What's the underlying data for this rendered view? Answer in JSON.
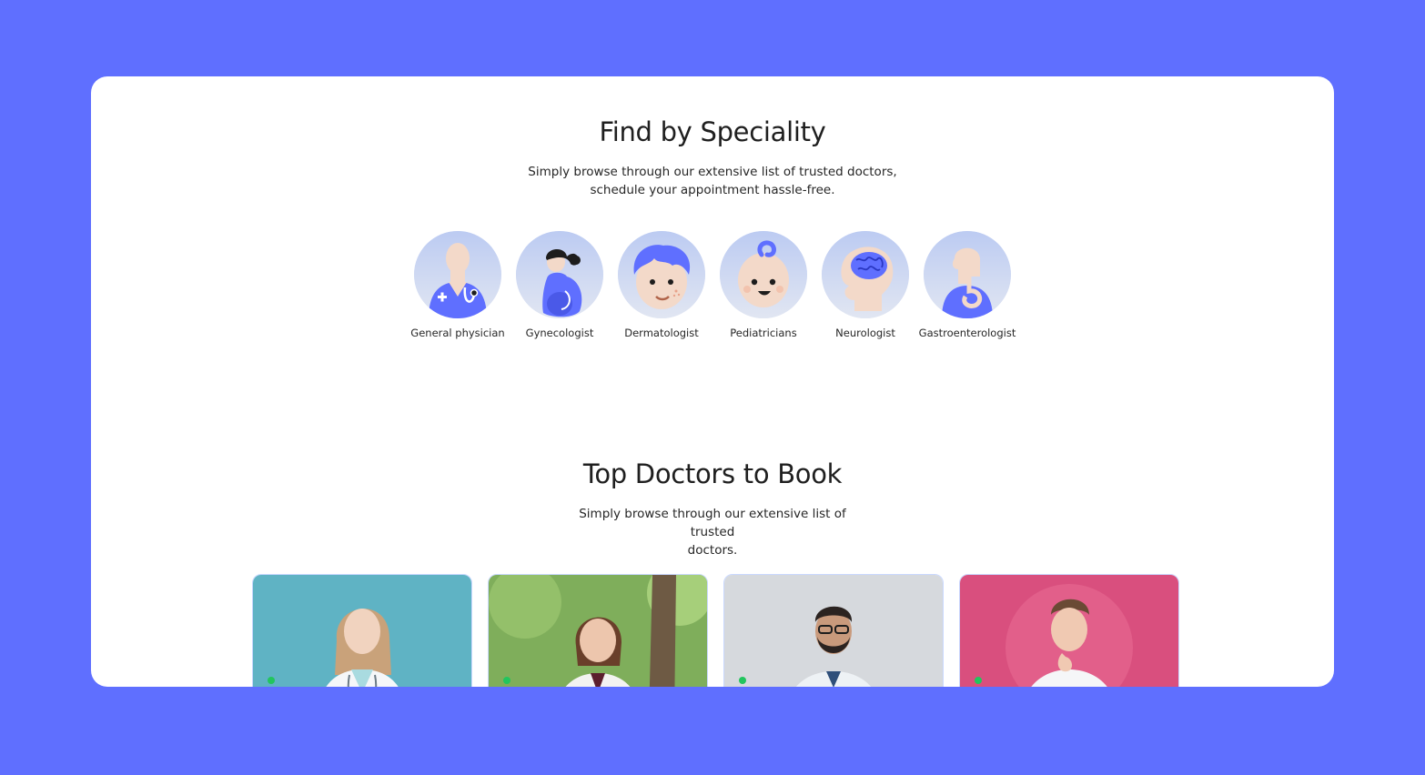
{
  "speciality": {
    "title": "Find by Speciality",
    "subtitle_line1": "Simply browse through our extensive list of trusted doctors,",
    "subtitle_line2": "schedule your appointment hassle-free.",
    "items": [
      {
        "label": "General physician",
        "icon": "general-physician-icon"
      },
      {
        "label": "Gynecologist",
        "icon": "gynecologist-icon"
      },
      {
        "label": "Dermatologist",
        "icon": "dermatologist-icon"
      },
      {
        "label": "Pediatricians",
        "icon": "pediatrician-icon"
      },
      {
        "label": "Neurologist",
        "icon": "neurologist-icon"
      },
      {
        "label": "Gastroenterologist",
        "icon": "gastroenterologist-icon"
      }
    ]
  },
  "top_doctors": {
    "title": "Top Doctors to Book",
    "subtitle_line1": "Simply browse through our extensive list of trusted",
    "subtitle_line2": "doctors.",
    "cards": [
      {
        "photo": "doctor-photo",
        "background": "#5fb3c4"
      },
      {
        "photo": "doctor-photo",
        "background": "#7fae5b"
      },
      {
        "photo": "doctor-photo",
        "background": "#d6d9dd"
      },
      {
        "photo": "doctor-photo",
        "background": "#d94f7e"
      }
    ]
  },
  "colors": {
    "page_background": "#5f6fff",
    "panel": "#ffffff",
    "accent": "#5f6fff",
    "available": "#22c55e"
  }
}
